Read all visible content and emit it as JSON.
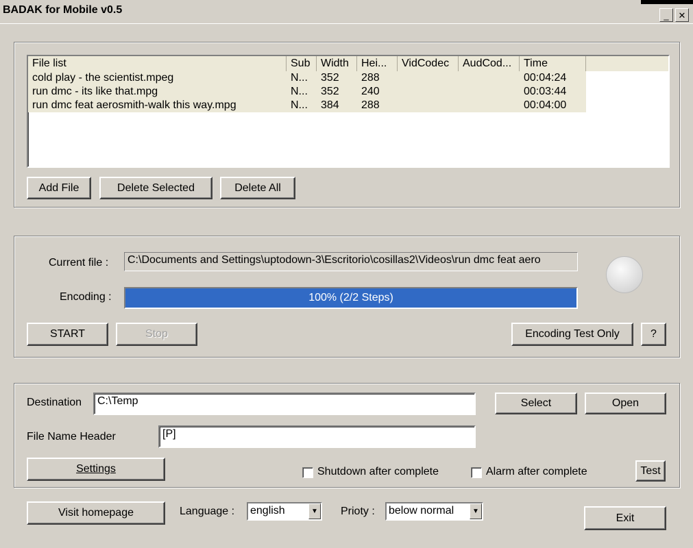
{
  "window": {
    "title": "BADAK for Mobile v0.5",
    "minimize_glyph": "_",
    "close_glyph": "✕"
  },
  "file_list": {
    "columns": [
      "File list",
      "Sub",
      "Width",
      "Hei...",
      "VidCodec",
      "AudCod...",
      "Time"
    ],
    "rows": [
      {
        "name": "cold play - the scientist.mpeg",
        "sub": "N...",
        "width": "352",
        "height": "288",
        "vidcodec": "",
        "audcodec": "",
        "time": "00:04:24"
      },
      {
        "name": "run dmc - its like that.mpg",
        "sub": "N...",
        "width": "352",
        "height": "240",
        "vidcodec": "",
        "audcodec": "",
        "time": "00:03:44"
      },
      {
        "name": "run dmc feat aerosmith-walk this way.mpg",
        "sub": "N...",
        "width": "384",
        "height": "288",
        "vidcodec": "",
        "audcodec": "",
        "time": "00:04:00"
      }
    ],
    "buttons": {
      "add": "Add File",
      "delete_selected": "Delete Selected",
      "delete_all": "Delete All"
    }
  },
  "encoding": {
    "current_file_label": "Current file :",
    "current_file_value": "C:\\Documents and Settings\\uptodown-3\\Escritorio\\cosillas2\\Videos\\run dmc feat aero",
    "encoding_label": "Encoding :",
    "progress_percent": 100,
    "progress_text": "100% (2/2 Steps)",
    "start_label": "START",
    "stop_label": "Stop",
    "test_only_label": "Encoding Test Only",
    "help_label": "?",
    "status_icon": "smiley-icon"
  },
  "output": {
    "destination_label": "Destination",
    "destination_value": "C:\\Temp",
    "select_label": "Select",
    "open_label": "Open",
    "header_label": "File Name Header",
    "header_value": "[P]",
    "settings_label": "Settings",
    "shutdown_label": "Shutdown after complete",
    "alarm_label": "Alarm after complete",
    "test_label": "Test"
  },
  "footer": {
    "homepage_label": "Visit homepage",
    "language_label": "Language :",
    "language_value": "english",
    "priority_label": "Prioty :",
    "priority_value": "below normal",
    "exit_label": "Exit",
    "dropdown_glyph": "▼"
  },
  "colors": {
    "face": "#d4d0c8",
    "progress": "#316ac5",
    "list_row": "#ece9d8"
  }
}
